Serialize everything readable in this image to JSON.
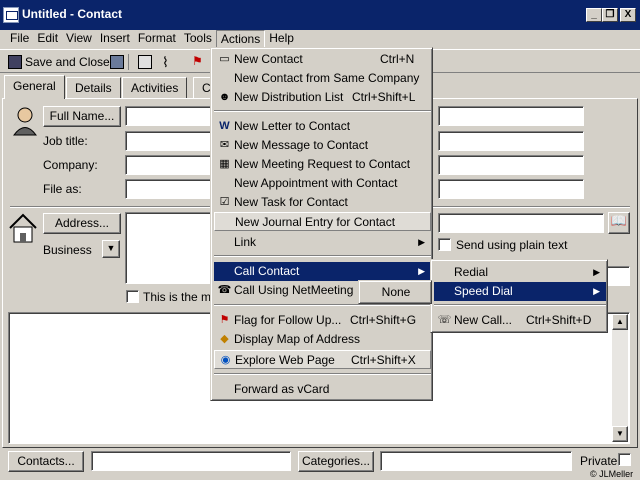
{
  "window": {
    "title": "Untitled - Contact",
    "minimize": "_",
    "restore": "❐",
    "close": "X"
  },
  "menubar": [
    "File",
    "Edit",
    "View",
    "Insert",
    "Format",
    "Tools",
    "Actions",
    "Help"
  ],
  "toolbar": {
    "save_close": "Save and Close"
  },
  "tabs": [
    "General",
    "Details",
    "Activities",
    "C"
  ],
  "form": {
    "full_name_button": "Full Name...",
    "job_title": "Job title:",
    "company": "Company:",
    "file_as": "File as:",
    "address_button": "Address...",
    "address_type": "Business",
    "mailing_label": "This is the mai",
    "send_plain_text": "Send using plain text",
    "contacts_button": "Contacts...",
    "categories_button": "Categories...",
    "private": "Private",
    "copyright": "© JLMeller"
  },
  "actions_menu": {
    "items": [
      {
        "label": "New Contact",
        "shortcut": "Ctrl+N"
      },
      {
        "label": "New Contact from Same Company",
        "shortcut": ""
      },
      {
        "label": "New Distribution List",
        "shortcut": "Ctrl+Shift+L"
      },
      {
        "label": "New Letter to Contact",
        "shortcut": ""
      },
      {
        "label": "New Message to Contact",
        "shortcut": ""
      },
      {
        "label": "New Meeting Request to Contact",
        "shortcut": ""
      },
      {
        "label": "New Appointment with Contact",
        "shortcut": ""
      },
      {
        "label": "New Task for Contact",
        "shortcut": ""
      },
      {
        "label": "New Journal Entry for Contact",
        "shortcut": ""
      },
      {
        "label": "Link",
        "shortcut": ""
      },
      {
        "label": "Call Contact",
        "shortcut": ""
      },
      {
        "label": "Call Using NetMeeting",
        "shortcut": ""
      },
      {
        "label": "Flag for Follow Up...",
        "shortcut": "Ctrl+Shift+G"
      },
      {
        "label": "Display Map of Address",
        "shortcut": ""
      },
      {
        "label": "Explore Web Page",
        "shortcut": "Ctrl+Shift+X"
      },
      {
        "label": "Forward as vCard",
        "shortcut": ""
      }
    ]
  },
  "call_submenu": {
    "items": [
      {
        "label": "Redial"
      },
      {
        "label": "Speed Dial"
      },
      {
        "label": "New Call...",
        "shortcut": "Ctrl+Shift+D"
      }
    ]
  },
  "speed_dial_submenu": {
    "none": "None"
  },
  "colors": {
    "titlebar": "#0a246a",
    "face": "#d4d0c8",
    "highlight": "#0a246a"
  }
}
